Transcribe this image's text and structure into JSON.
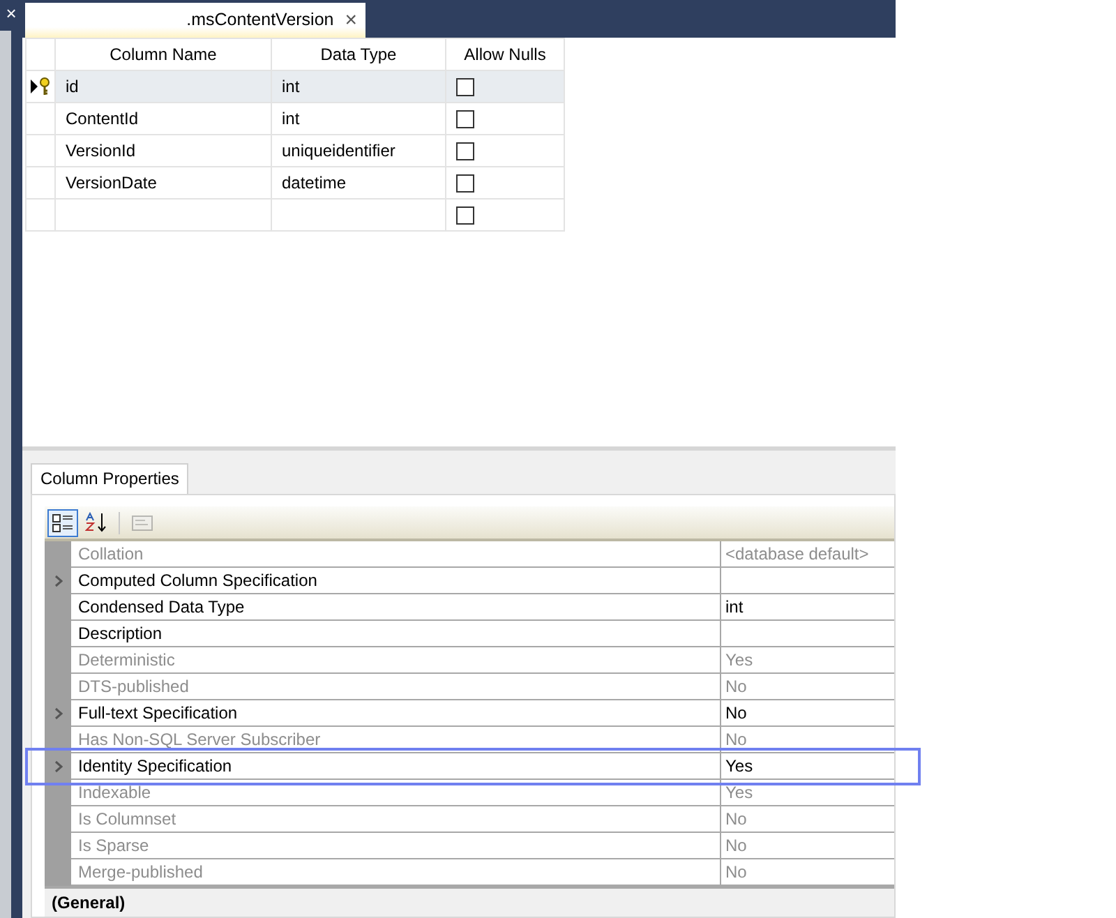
{
  "side_panel": {
    "close_glyph": "×"
  },
  "document_tab": {
    "title": ".msContentVersion",
    "close_glyph": "×",
    "selected": true
  },
  "table": {
    "columns": [
      "Column Name",
      "Data Type",
      "Allow Nulls"
    ],
    "rows": [
      {
        "name": "id",
        "data_type": "int",
        "allow_nulls": false,
        "selected": true,
        "primary_key": true
      },
      {
        "name": "ContentId",
        "data_type": "int",
        "allow_nulls": false,
        "selected": false,
        "primary_key": false
      },
      {
        "name": "VersionId",
        "data_type": "uniqueidentifier",
        "allow_nulls": false,
        "selected": false,
        "primary_key": false
      },
      {
        "name": "VersionDate",
        "data_type": "datetime",
        "allow_nulls": false,
        "selected": false,
        "primary_key": false
      },
      {
        "allow_nulls": false,
        "selected": false,
        "primary_key": false
      }
    ]
  },
  "properties_panel": {
    "tab": {
      "label": "Column Properties",
      "selected": true
    },
    "toolbar": [
      {
        "kind": "categorized",
        "selected": true,
        "disabled": false
      },
      {
        "kind": "alphabetical",
        "selected": false,
        "disabled": false
      },
      {
        "kind": "property_pages",
        "selected": false,
        "disabled": true
      }
    ],
    "properties": [
      {
        "name": "Collation",
        "value": "<database default>",
        "expandable": false,
        "disabled": true,
        "highlighted": false
      },
      {
        "name": "Computed Column Specification",
        "expandable": true,
        "disabled": false,
        "highlighted": false
      },
      {
        "name": "Condensed Data Type",
        "value": "int",
        "expandable": false,
        "disabled": false,
        "highlighted": false
      },
      {
        "name": "Description",
        "expandable": false,
        "disabled": false,
        "highlighted": false
      },
      {
        "name": "Deterministic",
        "value": "Yes",
        "expandable": false,
        "disabled": true,
        "highlighted": false
      },
      {
        "name": "DTS-published",
        "value": "No",
        "expandable": false,
        "disabled": true,
        "highlighted": false
      },
      {
        "name": "Full-text Specification",
        "value": "No",
        "expandable": true,
        "disabled": false,
        "highlighted": false
      },
      {
        "name": "Has Non-SQL Server Subscriber",
        "value": "No",
        "expandable": false,
        "disabled": true,
        "highlighted": false
      },
      {
        "name": "Identity Specification",
        "value": "Yes",
        "expandable": true,
        "disabled": false,
        "highlighted": true
      },
      {
        "name": "Indexable",
        "value": "Yes",
        "expandable": false,
        "disabled": true,
        "highlighted": false
      },
      {
        "name": "Is Columnset",
        "value": "No",
        "expandable": false,
        "disabled": true,
        "highlighted": false
      },
      {
        "name": "Is Sparse",
        "value": "No",
        "expandable": false,
        "disabled": true,
        "highlighted": false
      },
      {
        "name": "Merge-published",
        "value": "No",
        "expandable": false,
        "disabled": true,
        "highlighted": false
      }
    ],
    "description_title": "(General)"
  }
}
